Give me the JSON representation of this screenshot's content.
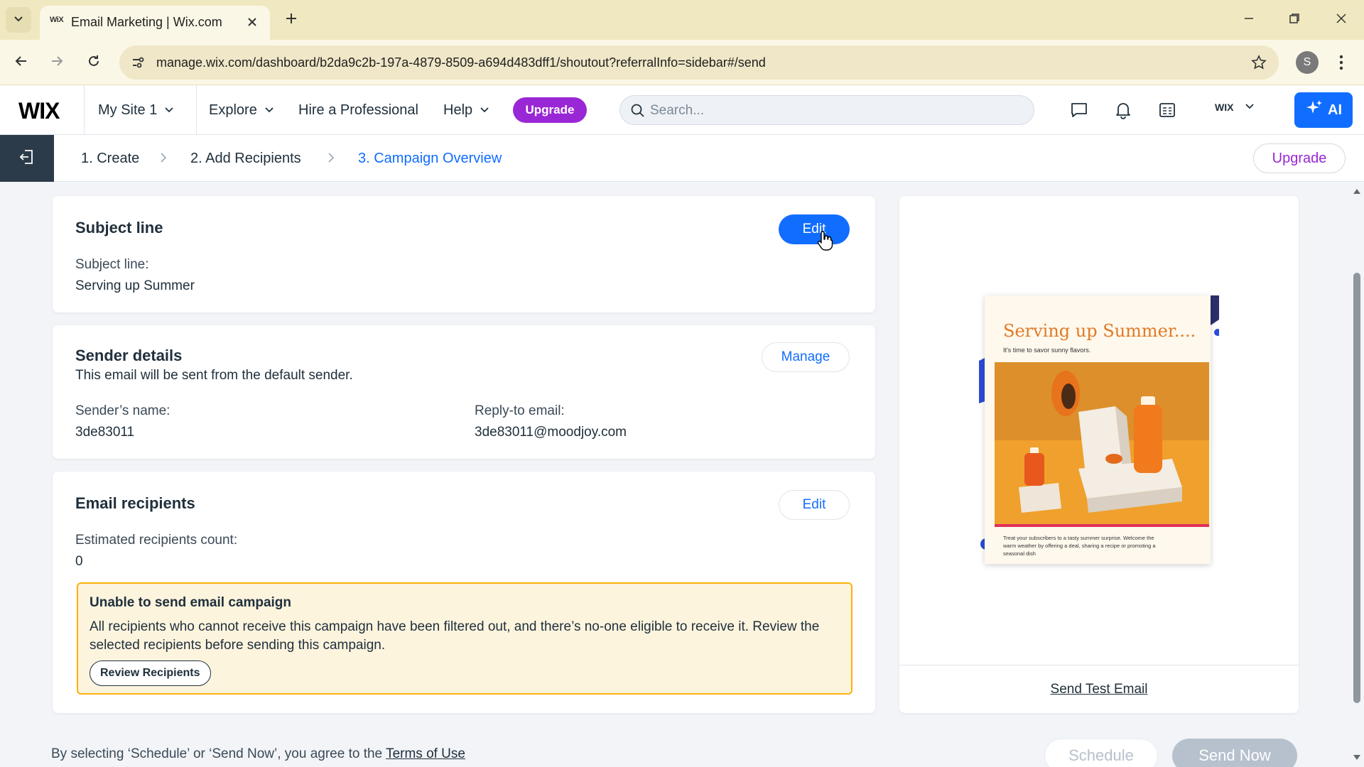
{
  "browser": {
    "tab_title": "Email Marketing | Wix.com",
    "tab_favicon": "WiX",
    "url": "manage.wix.com/dashboard/b2da9c2b-197a-4879-8509-a694d483dff1/shoutout?referralInfo=sidebar#/send",
    "profile_initial": "S"
  },
  "wix_header": {
    "logo": "WIX",
    "site_name": "My Site 1",
    "nav": {
      "explore": "Explore",
      "hire": "Hire a Professional",
      "help": "Help"
    },
    "upgrade": "Upgrade",
    "search_placeholder": "Search...",
    "account": "WIX",
    "ai_label": "AI"
  },
  "steps": {
    "items": [
      {
        "label": "1. Create"
      },
      {
        "label": "2. Add Recipients"
      },
      {
        "label": "3. Campaign Overview"
      }
    ],
    "upgrade": "Upgrade"
  },
  "subject": {
    "title": "Subject line",
    "edit": "Edit",
    "label": "Subject line:",
    "value": "Serving up Summer"
  },
  "sender": {
    "title": "Sender details",
    "description": "This email will be sent from the default sender.",
    "manage": "Manage",
    "name_label": "Sender’s name:",
    "name_value": "3de83011",
    "reply_label": "Reply-to email:",
    "reply_value": "3de83011@moodjoy.com"
  },
  "recipients": {
    "title": "Email recipients",
    "edit": "Edit",
    "count_label": "Estimated recipients count:",
    "count_value": "0",
    "warning": {
      "title": "Unable to send email campaign",
      "text": "All recipients who cannot receive this campaign have been filtered out, and there’s no-one eligible to receive it. Review the selected recipients before sending this campaign.",
      "button": "Review Recipients"
    }
  },
  "preview": {
    "email_title": "Serving up Summer....",
    "email_subtitle": "It's time to savor sunny flavors.",
    "email_body": "Treat your subscribers to a tasty summer surprise. Welcome the warm weather by offering a deal, sharing a recipe or promoting a seasonal dish",
    "send_test": "Send Test Email"
  },
  "footer": {
    "text": "By selecting ‘Schedule’ or ‘Send Now’, you agree to the ",
    "terms": "Terms of Use",
    "schedule": "Schedule",
    "send_now": "Send Now"
  },
  "colors": {
    "primary": "#116dff",
    "upgrade": "#9a27d5",
    "warning_border": "#fdb10c",
    "warning_bg": "#fdf4de"
  }
}
